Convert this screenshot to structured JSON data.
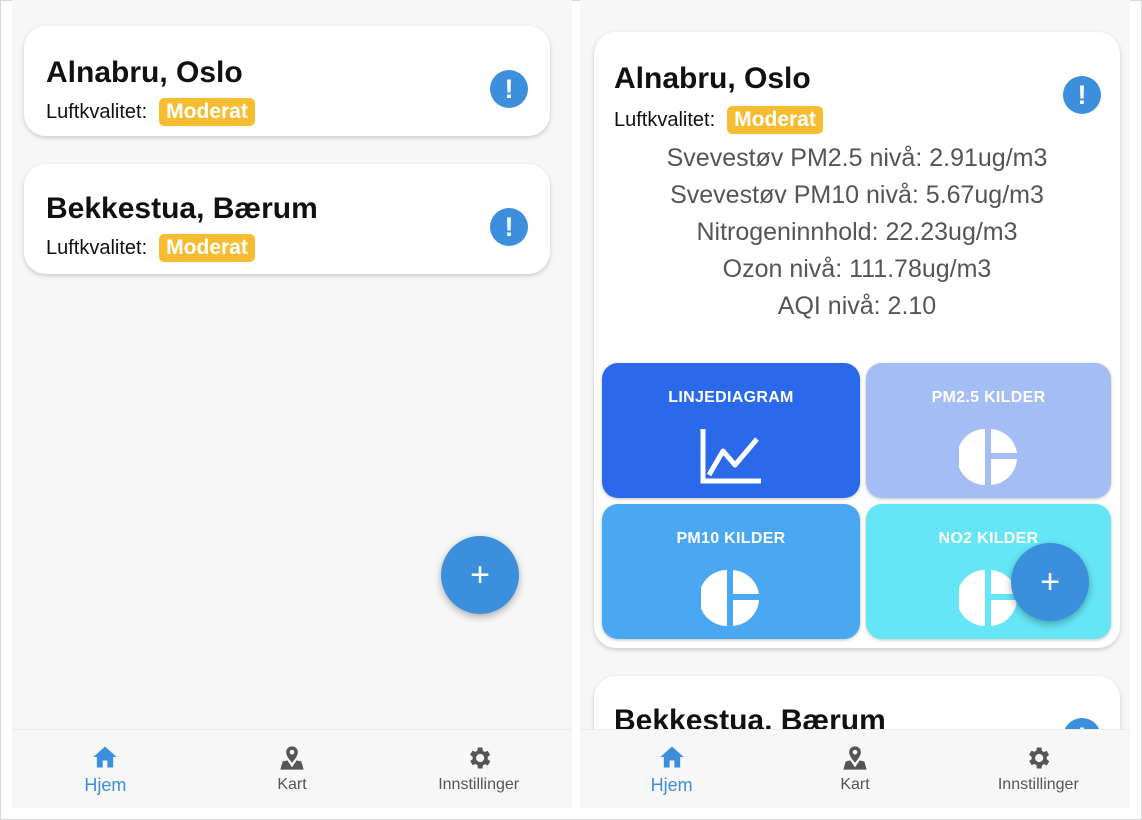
{
  "colors": {
    "accent": "#3c8fdd",
    "badge_moderat": "#f6bd33",
    "tile_linjediagram": "#2a6aea",
    "tile_pm25": "#a5bdf5",
    "tile_pm10": "#4aa8f2",
    "tile_no2": "#65e6f6"
  },
  "left": {
    "cards": [
      {
        "title": "Alnabru, Oslo",
        "aq_label": "Luftkvalitet:",
        "aq_value": "Moderat",
        "icon": "exclamation-icon"
      },
      {
        "title": "Bekkestua, Bærum",
        "aq_label": "Luftkvalitet:",
        "aq_value": "Moderat",
        "icon": "exclamation-icon"
      }
    ],
    "fab": "+",
    "nav": [
      {
        "label": "Hjem",
        "icon": "home-icon",
        "active": true
      },
      {
        "label": "Kart",
        "icon": "map-pin-icon",
        "active": false
      },
      {
        "label": "Innstillinger",
        "icon": "gear-icon",
        "active": false
      }
    ]
  },
  "right": {
    "expanded_card": {
      "title": "Alnabru, Oslo",
      "aq_label": "Luftkvalitet:",
      "aq_value": "Moderat",
      "metrics": [
        "Svevestøv PM2.5 nivå: 2.91ug/m3",
        "Svevestøv PM10 nivå: 5.67ug/m3",
        "Nitrogeninnhold: 22.23ug/m3",
        "Ozon nivå: 111.78ug/m3",
        "AQI nivå: 2.10"
      ],
      "tiles": [
        {
          "label": "LINJEDIAGRAM",
          "icon": "line-chart-icon"
        },
        {
          "label": "PM2.5 KILDER",
          "icon": "pie-chart-icon"
        },
        {
          "label": "PM10 KILDER",
          "icon": "pie-chart-icon"
        },
        {
          "label": "NO2 KILDER",
          "icon": "pie-chart-icon"
        }
      ]
    },
    "second_card": {
      "title": "Bekkestua, Bærum"
    },
    "fab": "+",
    "nav": [
      {
        "label": "Hjem",
        "icon": "home-icon",
        "active": true
      },
      {
        "label": "Kart",
        "icon": "map-pin-icon",
        "active": false
      },
      {
        "label": "Innstillinger",
        "icon": "gear-icon",
        "active": false
      }
    ]
  }
}
